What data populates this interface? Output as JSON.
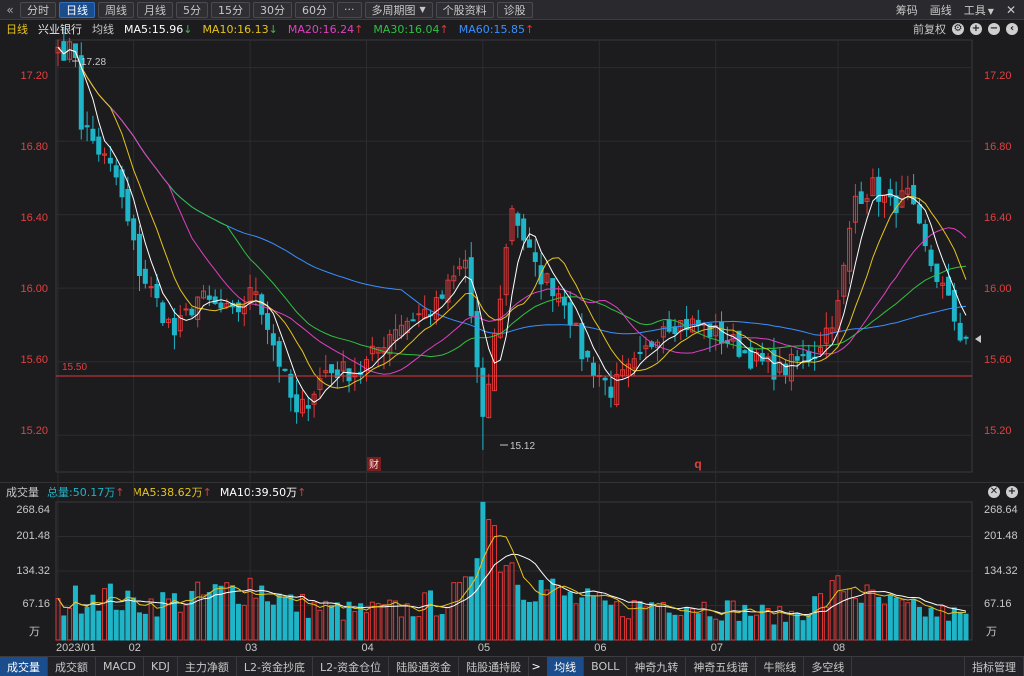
{
  "toolbar": {
    "tabs": [
      {
        "label": "分时",
        "active": false
      },
      {
        "label": "日线",
        "active": true
      },
      {
        "label": "周线",
        "active": false
      },
      {
        "label": "月线",
        "active": false
      },
      {
        "label": "5分",
        "active": false
      },
      {
        "label": "15分",
        "active": false
      },
      {
        "label": "30分",
        "active": false
      },
      {
        "label": "60分",
        "active": false
      },
      {
        "label": "···",
        "active": false
      }
    ],
    "multi_period": "多周期图",
    "stock_info": "个股资料",
    "diagnose": "诊股",
    "right": {
      "chips": "筹码",
      "draw": "画线",
      "tools": "工具"
    }
  },
  "ma_bar": {
    "period": "日线",
    "stock_name": "兴业银行",
    "mode": "均线",
    "ma5": "MA5:15.96",
    "ma10": "MA10:16.13",
    "ma20": "MA20:16.24",
    "ma30": "MA30:16.04",
    "ma60": "MA60:15.85",
    "adjust": "前复权"
  },
  "colors": {
    "ma5": "#ffffff",
    "ma10": "#e6c31e",
    "ma20": "#e040c0",
    "ma30": "#30c040",
    "ma60": "#3a90ff",
    "up": "#e03838",
    "down": "#1fb5c8",
    "axis": "#e04040"
  },
  "price_axis": {
    "ticks": [
      "17.20",
      "16.80",
      "16.40",
      "16.00",
      "15.60",
      "15.20"
    ]
  },
  "annotations": {
    "high": "17.28",
    "low": "15.12",
    "level": "15.50",
    "marker_fin": "财",
    "marker_q": "q"
  },
  "volume": {
    "title": "成交量",
    "total": "总量:50.17万",
    "ma5": "MA5:38.62万",
    "ma10": "MA10:39.50万",
    "ticks": [
      "268.64",
      "201.48",
      "134.32",
      "67.16",
      "万"
    ]
  },
  "date_axis": [
    "2023/01",
    "02",
    "03",
    "04",
    "05",
    "06",
    "07",
    "08"
  ],
  "bottom_tabs": {
    "left": [
      "成交量",
      "成交额",
      "MACD",
      "KDJ",
      "主力净额",
      "L2-资金抄底",
      "L2-资金仓位",
      "陆股通资金",
      "陆股通持股"
    ],
    "right": [
      "均线",
      "BOLL",
      "神奇九转",
      "神奇五线谱",
      "牛熊线",
      "多空线"
    ],
    "manage": "指标管理"
  },
  "chart_data": {
    "type": "candlestick",
    "price_range": [
      15.0,
      17.35
    ],
    "volume_range": [
      0,
      268.64
    ],
    "months": [
      {
        "label": "2023/01",
        "index": 0
      },
      {
        "label": "02",
        "index": 13
      },
      {
        "label": "03",
        "index": 33
      },
      {
        "label": "04",
        "index": 53
      },
      {
        "label": "05",
        "index": 73
      },
      {
        "label": "06",
        "index": 93
      },
      {
        "label": "07",
        "index": 113
      },
      {
        "label": "08",
        "index": 134
      }
    ],
    "key_points": [
      {
        "index": 3,
        "price": 17.28
      },
      {
        "index": 4,
        "price": 16.9
      },
      {
        "index": 10,
        "price": 16.6
      },
      {
        "index": 14,
        "price": 16.1
      },
      {
        "index": 20,
        "price": 15.75
      },
      {
        "index": 24,
        "price": 15.95
      },
      {
        "index": 30,
        "price": 15.85
      },
      {
        "index": 34,
        "price": 16.0
      },
      {
        "index": 38,
        "price": 15.6
      },
      {
        "index": 41,
        "price": 15.3
      },
      {
        "index": 46,
        "price": 15.55
      },
      {
        "index": 52,
        "price": 15.55
      },
      {
        "index": 58,
        "price": 15.8
      },
      {
        "index": 65,
        "price": 15.9
      },
      {
        "index": 70,
        "price": 16.15
      },
      {
        "index": 73,
        "price": 15.25
      },
      {
        "index": 78,
        "price": 16.45
      },
      {
        "index": 82,
        "price": 16.1
      },
      {
        "index": 87,
        "price": 15.95
      },
      {
        "index": 90,
        "price": 15.65
      },
      {
        "index": 95,
        "price": 15.45
      },
      {
        "index": 100,
        "price": 15.6
      },
      {
        "index": 104,
        "price": 15.82
      },
      {
        "index": 110,
        "price": 15.8
      },
      {
        "index": 116,
        "price": 15.7
      },
      {
        "index": 120,
        "price": 15.6
      },
      {
        "index": 124,
        "price": 15.55
      },
      {
        "index": 130,
        "price": 15.65
      },
      {
        "index": 134,
        "price": 15.9
      },
      {
        "index": 137,
        "price": 16.5
      },
      {
        "index": 140,
        "price": 16.55
      },
      {
        "index": 143,
        "price": 16.45
      },
      {
        "index": 146,
        "price": 16.5
      },
      {
        "index": 149,
        "price": 16.2
      },
      {
        "index": 152,
        "price": 16.0
      },
      {
        "index": 155,
        "price": 15.75
      }
    ],
    "volume_key_points": [
      {
        "index": 0,
        "value": 62
      },
      {
        "index": 6,
        "value": 95
      },
      {
        "index": 12,
        "value": 70
      },
      {
        "index": 20,
        "value": 75
      },
      {
        "index": 28,
        "value": 90
      },
      {
        "index": 33,
        "value": 110
      },
      {
        "index": 40,
        "value": 70
      },
      {
        "index": 50,
        "value": 55
      },
      {
        "index": 60,
        "value": 60
      },
      {
        "index": 66,
        "value": 75
      },
      {
        "index": 70,
        "value": 90
      },
      {
        "index": 73,
        "value": 268
      },
      {
        "index": 76,
        "value": 185
      },
      {
        "index": 80,
        "value": 120
      },
      {
        "index": 88,
        "value": 80
      },
      {
        "index": 96,
        "value": 60
      },
      {
        "index": 105,
        "value": 75
      },
      {
        "index": 115,
        "value": 60
      },
      {
        "index": 125,
        "value": 45
      },
      {
        "index": 132,
        "value": 80
      },
      {
        "index": 135,
        "value": 110
      },
      {
        "index": 140,
        "value": 75
      },
      {
        "index": 148,
        "value": 55
      },
      {
        "index": 155,
        "value": 48
      }
    ],
    "ma_last": {
      "ma5": 15.96,
      "ma10": 16.13,
      "ma20": 16.24,
      "ma30": 16.04,
      "ma60": 15.85
    },
    "volume_last": {
      "total": 50.17,
      "ma5": 38.62,
      "ma10": 39.5
    }
  }
}
